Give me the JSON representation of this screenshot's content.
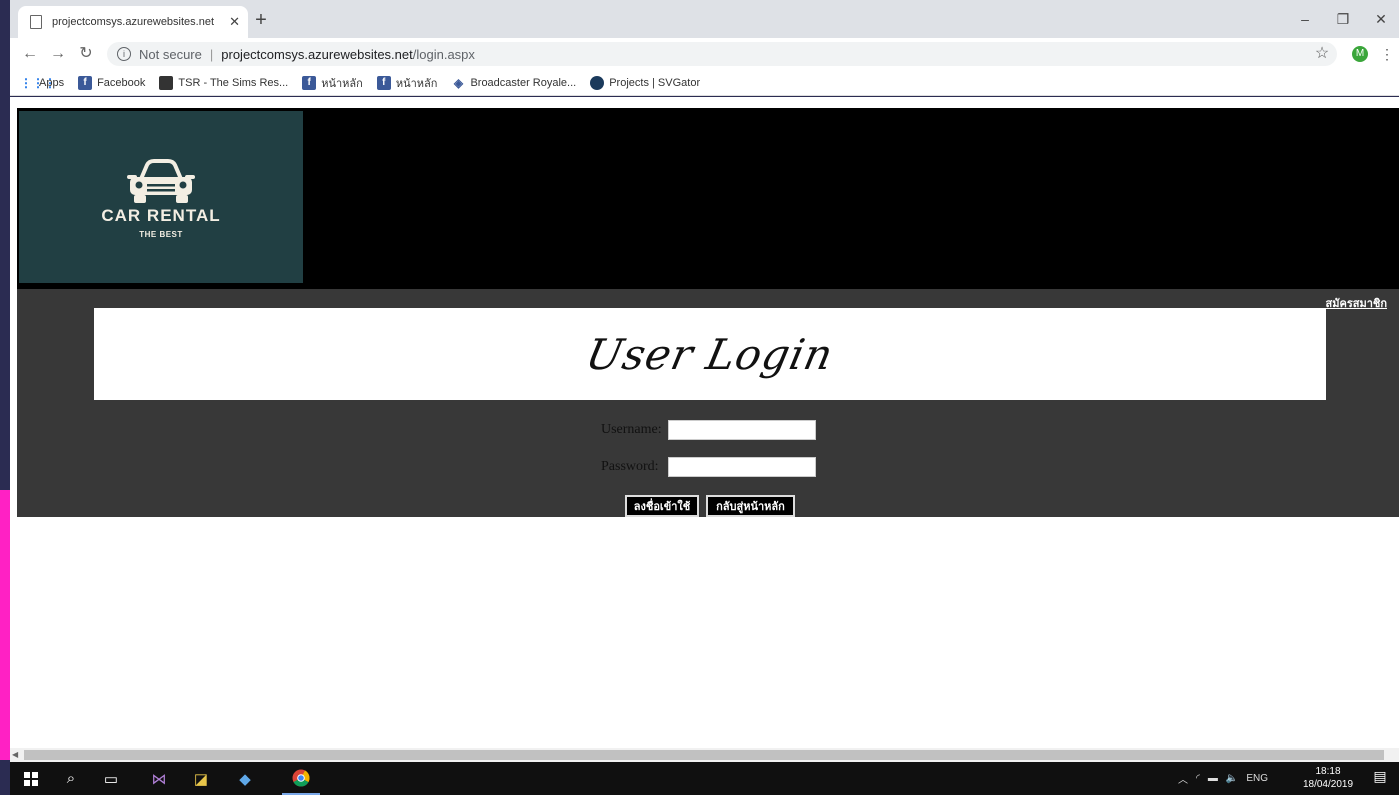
{
  "browser": {
    "tab_title": "projectcomsys.azurewebsites.net",
    "tab_close": "✕",
    "new_tab": "+",
    "not_secure": "Not secure",
    "url_host": "projectcomsys.azurewebsites.net",
    "url_path": "/login.aspx",
    "avatar_letter": "M",
    "bookmarks": [
      "Apps",
      "Facebook",
      "TSR - The Sims Res...",
      "หน้าหลัก",
      "หน้าหลัก",
      "Broadcaster Royale...",
      "Projects | SVGator"
    ]
  },
  "site": {
    "logo_title": "CAR RENTAL",
    "logo_subtitle": "THE BEST",
    "register_link": "สมัครสมาชิก",
    "page_heading": "User Login",
    "username_label": "Username:",
    "password_label": "Password:",
    "username_value": "",
    "password_value": "",
    "login_button": "ลงชื่อเข้าใช้",
    "home_button": "กลับสู่หน้าหลัก"
  },
  "taskbar": {
    "language": "ENG",
    "time": "18:18",
    "date": "18/04/2019"
  },
  "colors": {
    "logo_bg": "#213f43",
    "panel_bg": "#383838",
    "hero_bg": "#000000"
  }
}
